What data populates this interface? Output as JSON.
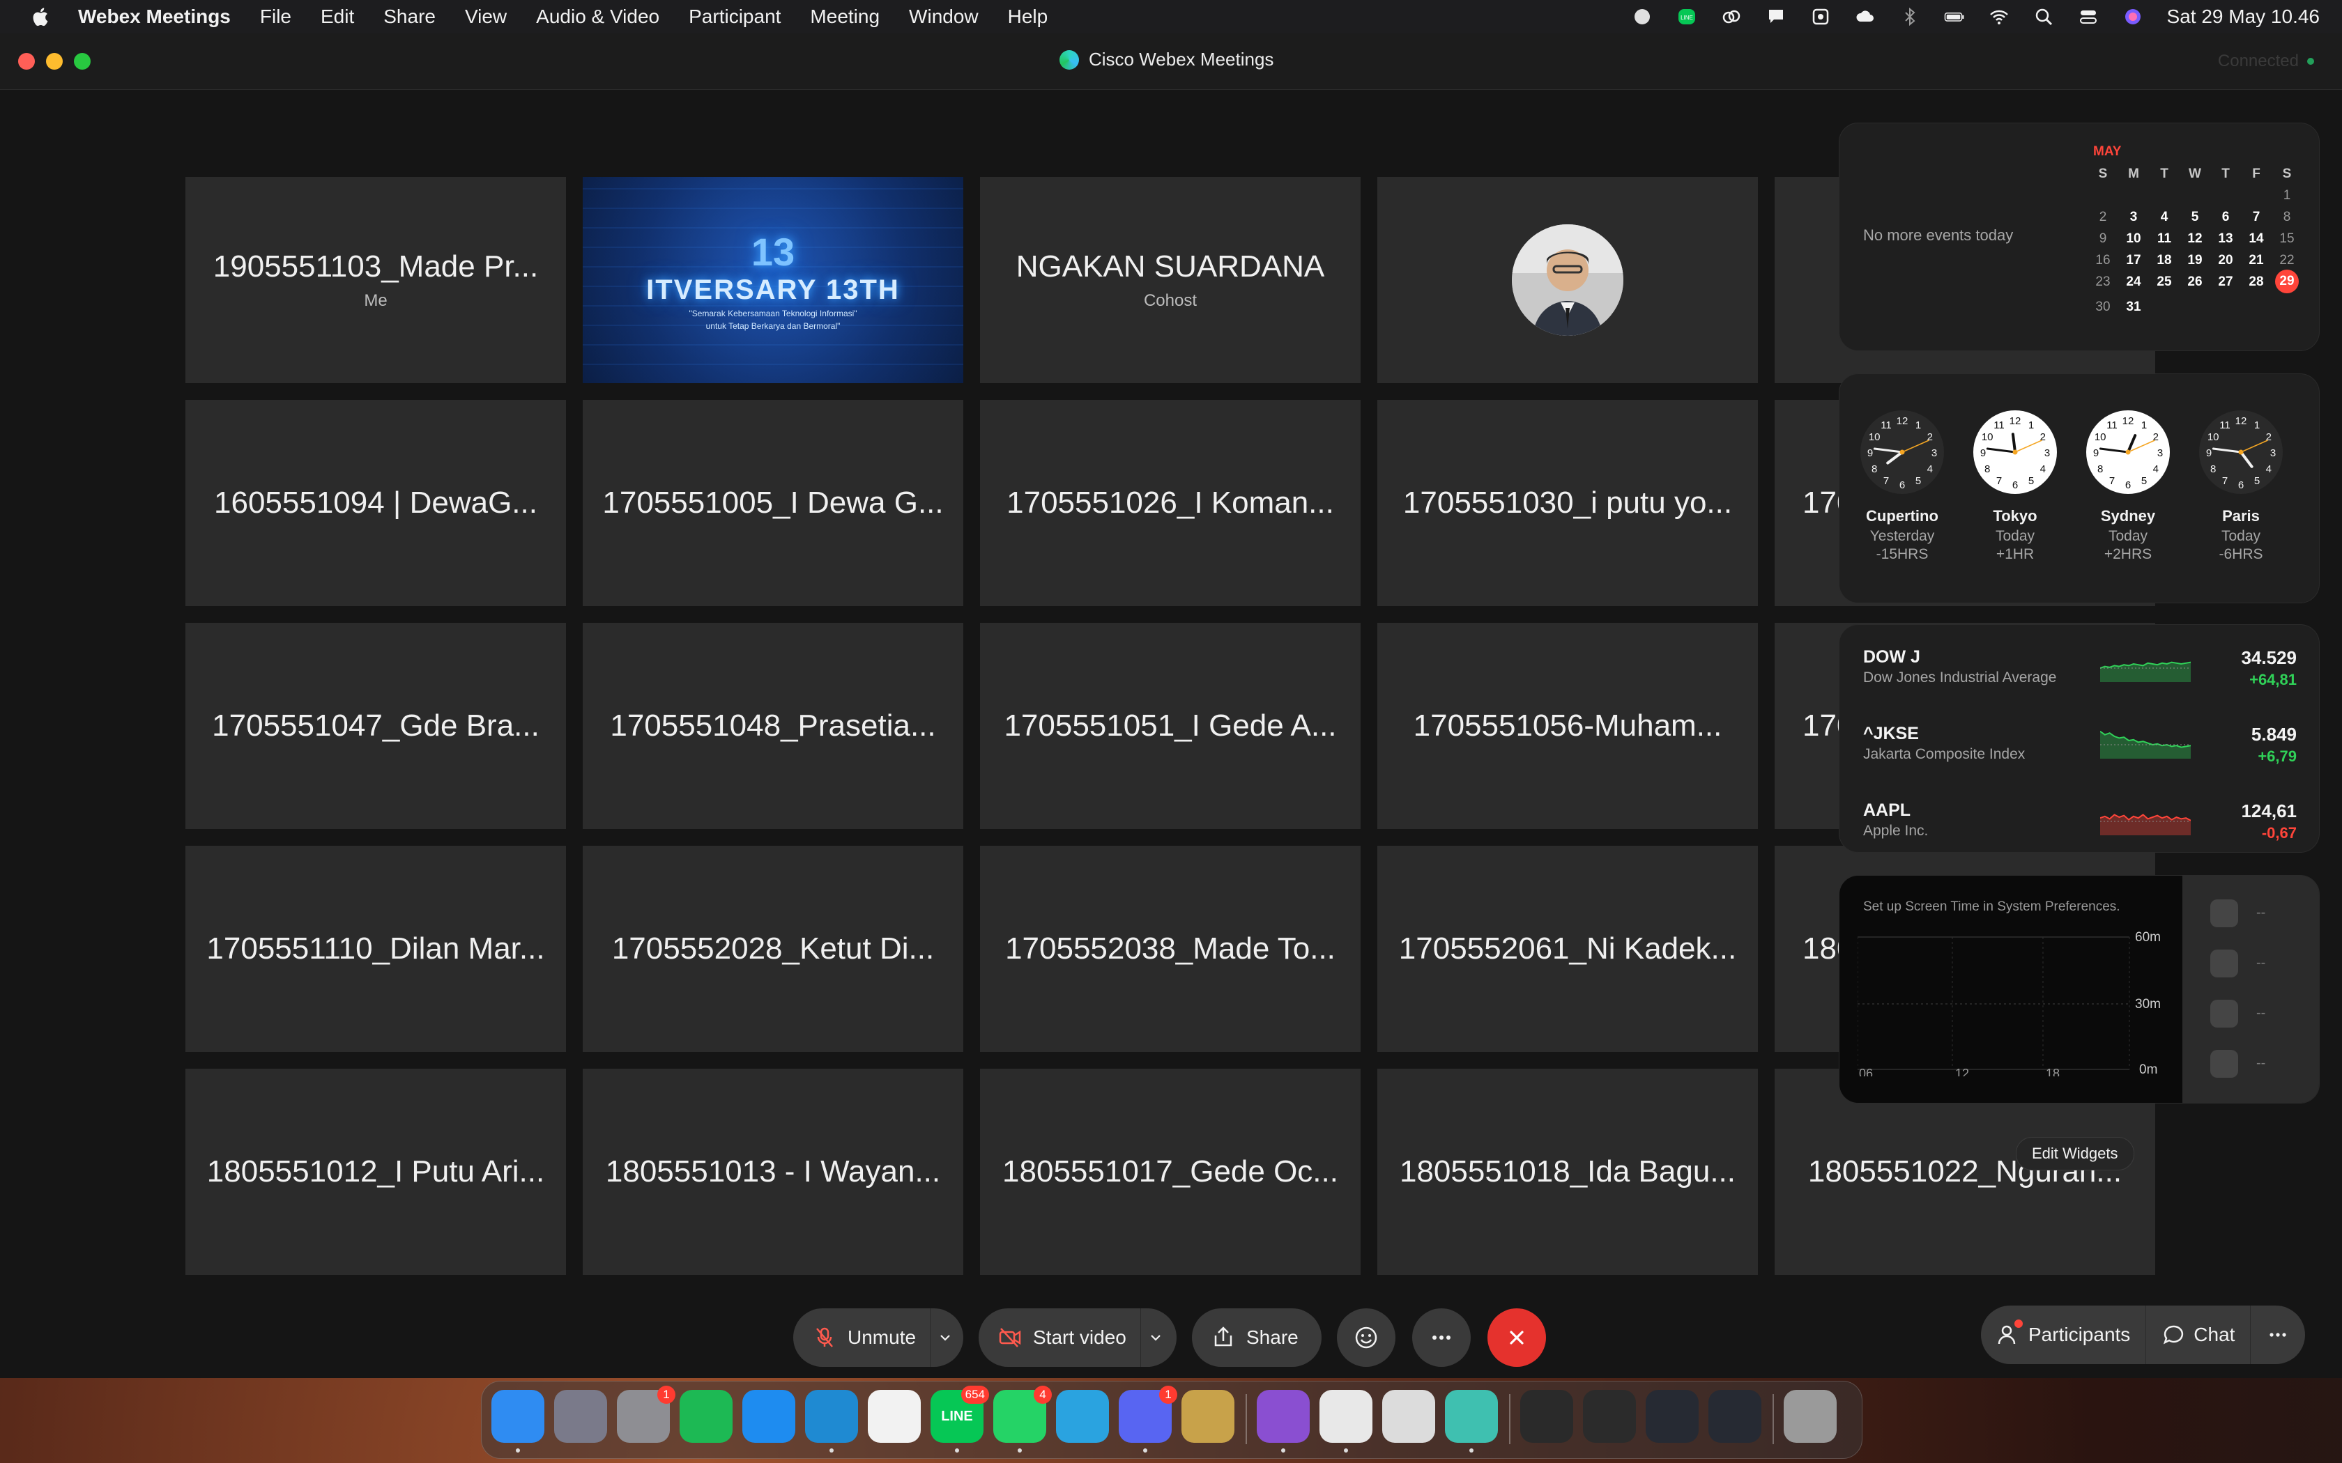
{
  "menubar": {
    "app_name": "Webex Meetings",
    "menus": [
      "File",
      "Edit",
      "Share",
      "View",
      "Audio & Video",
      "Participant",
      "Meeting",
      "Window",
      "Help"
    ],
    "datetime": "Sat 29 May  10.46",
    "status_icons": [
      "circle-status-icon",
      "line-icon",
      "creative-cloud-icon",
      "notification-icon",
      "remote-icon",
      "cloud-icon",
      "bluetooth-off-icon",
      "battery-icon",
      "wifi-icon",
      "spotlight-icon",
      "control-center-icon",
      "siri-icon"
    ]
  },
  "window": {
    "title": "Cisco Webex Meetings",
    "connection_status": "Connected"
  },
  "grid": {
    "tiles": [
      {
        "name": "1905551103_Made Pr...",
        "role": "Me",
        "kind": "text"
      },
      {
        "name": "",
        "role": "",
        "kind": "banner"
      },
      {
        "name": "NGAKAN SUARDANA",
        "role": "Cohost",
        "kind": "text"
      },
      {
        "name": "",
        "role": "",
        "kind": "avatar"
      },
      {
        "name": "",
        "role": "",
        "kind": "text"
      },
      {
        "name": "1605551094 | DewaG...",
        "role": "",
        "kind": "text"
      },
      {
        "name": "1705551005_I Dewa G...",
        "role": "",
        "kind": "text"
      },
      {
        "name": "1705551026_I Koman...",
        "role": "",
        "kind": "text"
      },
      {
        "name": "1705551030_i putu yo...",
        "role": "",
        "kind": "text"
      },
      {
        "name": "170",
        "role": "",
        "kind": "partial"
      },
      {
        "name": "1705551047_Gde Bra...",
        "role": "",
        "kind": "text"
      },
      {
        "name": "1705551048_Prasetia...",
        "role": "",
        "kind": "text"
      },
      {
        "name": "1705551051_I Gede A...",
        "role": "",
        "kind": "text"
      },
      {
        "name": "1705551056-Muham...",
        "role": "",
        "kind": "text"
      },
      {
        "name": "170",
        "role": "",
        "kind": "partial"
      },
      {
        "name": "1705551110_Dilan Mar...",
        "role": "",
        "kind": "text"
      },
      {
        "name": "1705552028_Ketut Di...",
        "role": "",
        "kind": "text"
      },
      {
        "name": "1705552038_Made To...",
        "role": "",
        "kind": "text"
      },
      {
        "name": "1705552061_Ni Kadek...",
        "role": "",
        "kind": "text"
      },
      {
        "name": "180",
        "role": "",
        "kind": "partial"
      },
      {
        "name": "1805551012_I Putu Ari...",
        "role": "",
        "kind": "text"
      },
      {
        "name": "1805551013 - I Wayan...",
        "role": "",
        "kind": "text"
      },
      {
        "name": "1805551017_Gede Oc...",
        "role": "",
        "kind": "text"
      },
      {
        "name": "1805551018_Ida Bagu...",
        "role": "",
        "kind": "text"
      },
      {
        "name": "1805551022_Ngurah...",
        "role": "",
        "kind": "text"
      }
    ],
    "banner": {
      "number": "13",
      "title": "ITVERSARY 13TH",
      "subtitle": "\"Semarak Kebersamaan Teknologi Informasi\"",
      "subtitle2": "untuk Tetap Berkarya dan Bermoral\""
    }
  },
  "widgets": {
    "calendar": {
      "no_events": "No more events today",
      "month": "MAY",
      "day_headers": [
        "S",
        "M",
        "T",
        "W",
        "T",
        "F",
        "S"
      ],
      "weeks": [
        [
          "",
          "",
          "",
          "",
          "",
          "",
          "1"
        ],
        [
          "2",
          "3",
          "4",
          "5",
          "6",
          "7",
          "8"
        ],
        [
          "9",
          "10",
          "11",
          "12",
          "13",
          "14",
          "15"
        ],
        [
          "16",
          "17",
          "18",
          "19",
          "20",
          "21",
          "22"
        ],
        [
          "23",
          "24",
          "25",
          "26",
          "27",
          "28",
          "29"
        ],
        [
          "30",
          "31",
          "",
          "",
          "",
          "",
          ""
        ]
      ],
      "today": "29"
    },
    "clocks": [
      {
        "city": "Cupertino",
        "day": "Yesterday",
        "offset": "-15HRS",
        "hour": 19.77
      },
      {
        "city": "Tokyo",
        "day": "Today",
        "offset": "+1HR",
        "hour": 11.77
      },
      {
        "city": "Sydney",
        "day": "Today",
        "offset": "+2HRS",
        "hour": 12.77
      },
      {
        "city": "Paris",
        "day": "Today",
        "offset": "-6HRS",
        "hour": 4.77
      }
    ],
    "stocks": [
      {
        "symbol": "DOW J",
        "name": "Dow Jones Industrial Average",
        "price": "34.529",
        "change": "+64,81",
        "direction": "up"
      },
      {
        "symbol": "^JKSE",
        "name": "Jakarta Composite Index",
        "price": "5.849",
        "change": "+6,79",
        "direction": "up"
      },
      {
        "symbol": "AAPL",
        "name": "Apple Inc.",
        "price": "124,61",
        "change": "-0,67",
        "direction": "down"
      }
    ],
    "screen_time": {
      "message": "Set up Screen Time in System Preferences.",
      "y_labels": [
        "60m",
        "30m",
        "0m"
      ],
      "x_labels": [
        "06",
        "12",
        "18"
      ],
      "placeholder": "--"
    },
    "edit_label": "Edit Widgets"
  },
  "controls": {
    "unmute": "Unmute",
    "start_video": "Start video",
    "share": "Share",
    "participants": "Participants",
    "chat": "Chat"
  },
  "dock": {
    "apps": [
      {
        "name": "finder-icon",
        "color": "#2f8cf2",
        "label": "",
        "badge": ""
      },
      {
        "name": "launchpad-icon",
        "color": "#7a7a8a",
        "label": "",
        "badge": ""
      },
      {
        "name": "system-preferences-icon",
        "color": "#8e8e93",
        "label": "",
        "badge": "1"
      },
      {
        "name": "spotify-icon",
        "color": "#1db954",
        "label": "",
        "badge": ""
      },
      {
        "name": "safari-icon",
        "color": "#1e8cf0",
        "label": "",
        "badge": ""
      },
      {
        "name": "vscode-icon",
        "color": "#1f8ad2",
        "label": "",
        "badge": ""
      },
      {
        "name": "app-store-icon",
        "color": "#f2f2f2",
        "label": "",
        "badge": ""
      },
      {
        "name": "line-icon",
        "color": "#06c755",
        "label": "LINE",
        "badge": "654"
      },
      {
        "name": "whatsapp-icon",
        "color": "#25d366",
        "label": "",
        "badge": "4"
      },
      {
        "name": "telegram-icon",
        "color": "#2aa3e0",
        "label": "",
        "badge": ""
      },
      {
        "name": "discord-icon",
        "color": "#5865f2",
        "label": "",
        "badge": "1"
      },
      {
        "name": "archive-utility-icon",
        "color": "#c8a24a",
        "label": "",
        "badge": ""
      },
      {
        "name": "github-desktop-icon",
        "color": "#8a4fd1",
        "label": "",
        "badge": ""
      },
      {
        "name": "chrome-icon",
        "color": "#e8e8e8",
        "label": "",
        "badge": ""
      },
      {
        "name": "cleanmymac-icon",
        "color": "#dcdcdc",
        "label": "",
        "badge": ""
      },
      {
        "name": "webex-icon",
        "color": "#3fc0b0",
        "label": "",
        "badge": ""
      },
      {
        "name": "minimized-window-1",
        "color": "#2a2a2a",
        "label": "",
        "badge": ""
      },
      {
        "name": "minimized-window-2",
        "color": "#2b2b2b",
        "label": "",
        "badge": ""
      },
      {
        "name": "minimized-window-3",
        "color": "#262a33",
        "label": "",
        "badge": ""
      },
      {
        "name": "minimized-window-4",
        "color": "#262a33",
        "label": "",
        "badge": ""
      },
      {
        "name": "trash-icon",
        "color": "#9a9a9a",
        "label": "",
        "badge": ""
      }
    ]
  }
}
